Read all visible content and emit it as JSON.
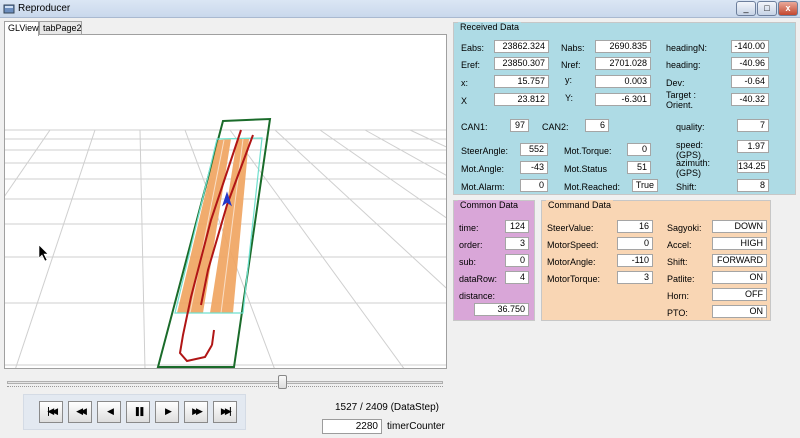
{
  "window": {
    "title": "Reproducer",
    "min_glyph": "_",
    "max_glyph": "□",
    "close_glyph": "x"
  },
  "tabs": [
    "GLView",
    "tabPage2"
  ],
  "playback": {
    "slider_fraction": 0.634,
    "buttons": [
      {
        "name": "skip-to-start-button",
        "glyph": "|◀◀"
      },
      {
        "name": "fast-rewind-button",
        "glyph": "◀◀"
      },
      {
        "name": "step-back-button",
        "glyph": "◀"
      },
      {
        "name": "pause-button",
        "glyph": "❚❚"
      },
      {
        "name": "step-forward-button",
        "glyph": "▶"
      },
      {
        "name": "fast-forward-button",
        "glyph": "▶▶"
      },
      {
        "name": "skip-to-end-button",
        "glyph": "▶▶|"
      }
    ],
    "datastep": "1527 / 2409 (DataStep)",
    "timer_value": "2280",
    "timer_label": "timerCounter"
  },
  "received": {
    "title": "Received Data",
    "fields": [
      {
        "label": "Eabs:",
        "value": "23862.324"
      },
      {
        "label": "Nabs:",
        "value": "2690.835"
      },
      {
        "label": "headingN:",
        "value": "-140.00"
      },
      {
        "label": "Eref:",
        "value": "23850.307"
      },
      {
        "label": "Nref:",
        "value": "2701.028"
      },
      {
        "label": "heading:",
        "value": "-40.96"
      },
      {
        "label": "x:",
        "value": "15.757"
      },
      {
        "label": "y:",
        "value": "0.003"
      },
      {
        "label": "Dev:",
        "value": "-0.64"
      },
      {
        "label": "X",
        "value": "23.812"
      },
      {
        "label": "Y:",
        "value": "-6.301"
      },
      {
        "label": "Target : Orient.",
        "value": "-40.32"
      },
      {
        "label": "CAN1:",
        "value": "97"
      },
      {
        "label": "CAN2:",
        "value": "6"
      },
      {
        "label": "quality:",
        "value": "7"
      },
      {
        "label": "SteerAngle:",
        "value": "552"
      },
      {
        "label": "Mot.Torque:",
        "value": "0"
      },
      {
        "label": "speed: (GPS)",
        "value": "1.97"
      },
      {
        "label": "Mot.Angle:",
        "value": "-43"
      },
      {
        "label": "Mot.Status",
        "value": "51"
      },
      {
        "label": "azimuth: (GPS)",
        "value": "134.25"
      },
      {
        "label": "Mot.Alarm:",
        "value": "0"
      },
      {
        "label": "Mot.Reached:",
        "value": "True"
      },
      {
        "label": "Shift:",
        "value": "8"
      }
    ]
  },
  "common": {
    "title": "Common Data",
    "fields": [
      {
        "label": "time:",
        "value": "124"
      },
      {
        "label": "order:",
        "value": "3"
      },
      {
        "label": "sub:",
        "value": "0"
      },
      {
        "label": "dataRow:",
        "value": "4"
      },
      {
        "label": "distance:",
        "value": "36.750"
      }
    ]
  },
  "command": {
    "title": "Command Data",
    "fields": [
      {
        "label": "SteerValue:",
        "value": "16"
      },
      {
        "label": "Sagyoki:",
        "value": "DOWN"
      },
      {
        "label": "MotorSpeed:",
        "value": "0"
      },
      {
        "label": "Accel:",
        "value": "HIGH"
      },
      {
        "label": "MotorAngle:",
        "value": "-110"
      },
      {
        "label": "Shift:",
        "value": "FORWARD"
      },
      {
        "label": "MotorTorque:",
        "value": "3"
      },
      {
        "label": "Patlite:",
        "value": "ON"
      },
      {
        "label": "Horn:",
        "value": "OFF"
      },
      {
        "label": "PTO:",
        "value": "ON"
      }
    ]
  },
  "colors": {
    "received_bg": "#aedbe5",
    "common_bg": "#d9a6d8",
    "command_bg": "#f9d6b4",
    "field_boundary": "#1a6b2a",
    "work_strip": "#f0a35e",
    "path": "#b01515",
    "vehicle": "#2438c8"
  }
}
